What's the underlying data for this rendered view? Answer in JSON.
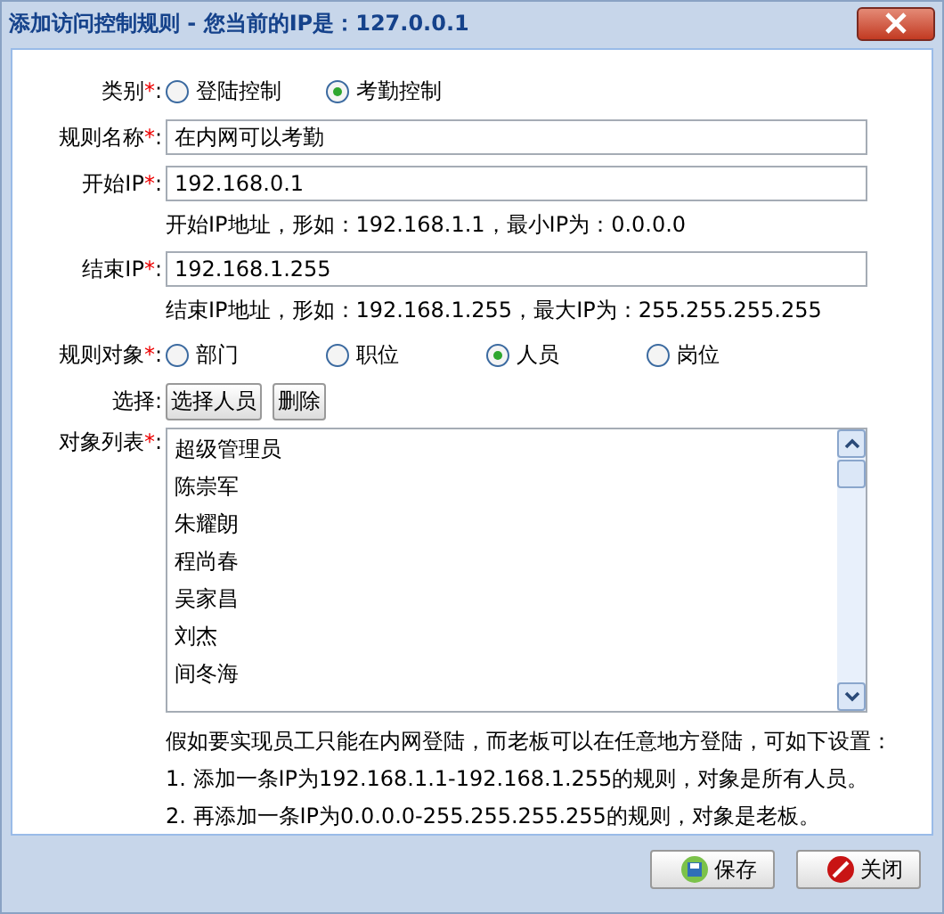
{
  "window": {
    "title": "添加访问控制规则 - 您当前的IP是：127.0.0.1"
  },
  "category": {
    "label": "类别",
    "required_mark": "*",
    "suffix": ":",
    "options": [
      {
        "label": "登陆控制",
        "selected": false
      },
      {
        "label": "考勤控制",
        "selected": true
      }
    ]
  },
  "fields": [
    {
      "label": "规则名称",
      "required_mark": "*",
      "suffix": ":",
      "value": "在内网可以考勤"
    },
    {
      "label": "开始IP",
      "required_mark": "*",
      "suffix": ":",
      "value": "192.168.0.1",
      "hint": "开始IP地址，形如：192.168.1.1，最小IP为：0.0.0.0"
    },
    {
      "label": "结束IP",
      "required_mark": "*",
      "suffix": ":",
      "value": "192.168.1.255",
      "hint": "结束IP地址，形如：192.168.1.255，最大IP为：255.255.255.255"
    }
  ],
  "rule_object": {
    "label": "规则对象",
    "required_mark": "*",
    "suffix": ":",
    "options": [
      {
        "label": "部门",
        "selected": false
      },
      {
        "label": "职位",
        "selected": false
      },
      {
        "label": "人员",
        "selected": true
      },
      {
        "label": "岗位",
        "selected": false
      }
    ]
  },
  "select": {
    "label": "选择:",
    "buttons": [
      "选择人员",
      "删除"
    ]
  },
  "object_list": {
    "label": "对象列表",
    "required_mark": "*",
    "suffix": ":",
    "items": [
      "超级管理员",
      "陈崇军",
      "朱耀朗",
      "程尚春",
      "吴家昌",
      "刘杰",
      "间冬海"
    ]
  },
  "notes": [
    "假如要实现员工只能在内网登陆，而老板可以在任意地方登陆，可如下设置：",
    "1. 添加一条IP为192.168.1.1-192.168.1.255的规则，对象是所有人员。",
    "2. 再添加一条IP为0.0.0.0-255.255.255.255的规则，对象是老板。"
  ],
  "footer_buttons": [
    {
      "label": "保存",
      "kind": "save"
    },
    {
      "label": "关闭",
      "kind": "close"
    }
  ]
}
